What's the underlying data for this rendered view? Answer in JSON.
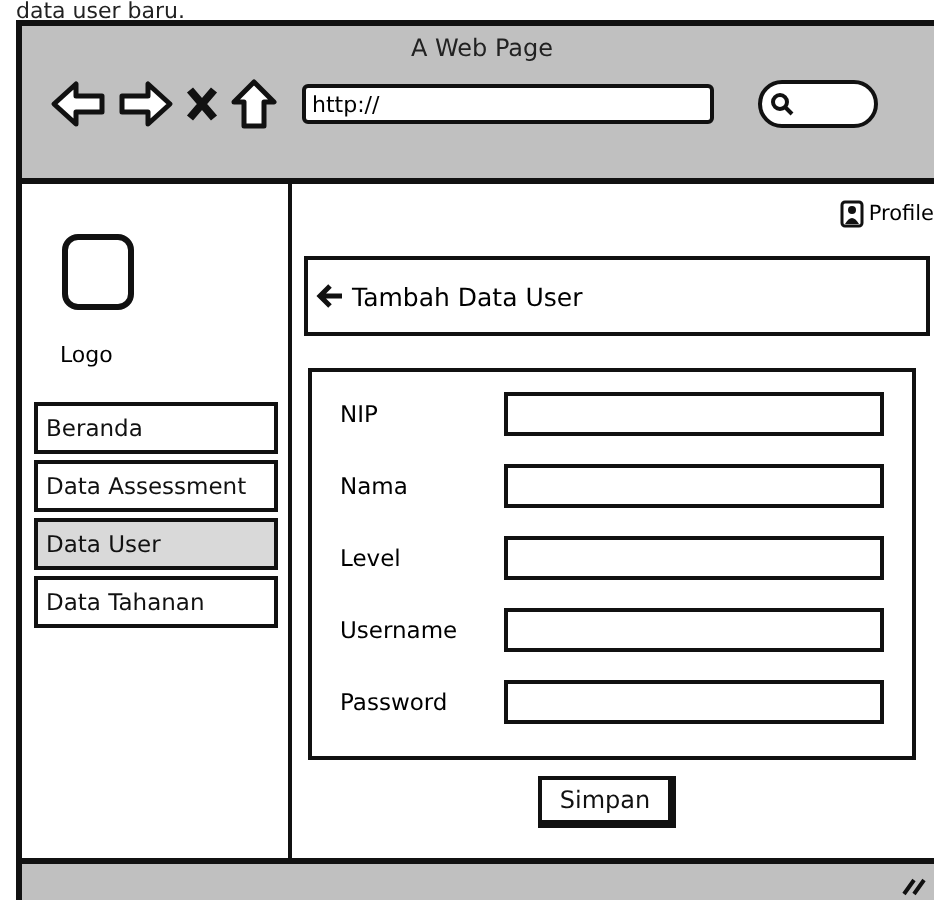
{
  "caption": "data user baru.",
  "browser": {
    "title": "A Web Page",
    "address": "http://"
  },
  "sidebar": {
    "logo_label": "Logo",
    "items": [
      {
        "label": "Beranda",
        "selected": false
      },
      {
        "label": "Data Assessment",
        "selected": false
      },
      {
        "label": "Data User",
        "selected": true
      },
      {
        "label": "Data Tahanan",
        "selected": false
      }
    ]
  },
  "header": {
    "profile": "Profile",
    "title": "Tambah Data User"
  },
  "form": {
    "fields": [
      {
        "label": "NIP"
      },
      {
        "label": "Nama"
      },
      {
        "label": "Level"
      },
      {
        "label": "Username"
      },
      {
        "label": "Password"
      }
    ],
    "submit": "Simpan"
  }
}
